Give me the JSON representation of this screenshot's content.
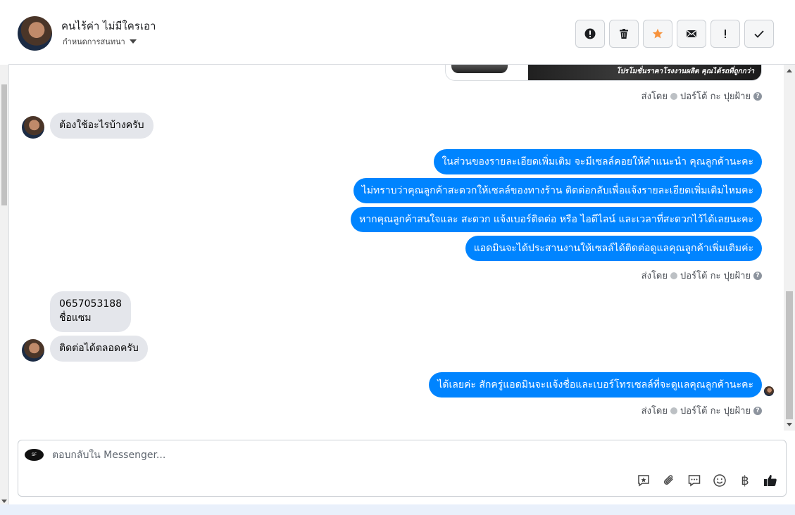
{
  "header": {
    "contact_name": "คนไร้ค่า ไม่มีใครเอา",
    "assign_label": "กำหนดการสนทนา"
  },
  "actions": [
    {
      "name": "mark-spam",
      "icon": "alert-circle-icon"
    },
    {
      "name": "delete",
      "icon": "trash-icon"
    },
    {
      "name": "star",
      "icon": "star-icon",
      "color": "#f7923b"
    },
    {
      "name": "mark-unread",
      "icon": "envelope-icon"
    },
    {
      "name": "follow-up",
      "icon": "exclamation-icon"
    },
    {
      "name": "done",
      "icon": "checkmark-icon"
    }
  ],
  "promo_banner_text": "โปรโมชั่นราคาโรงงานผลิต คุณได้รถที่ถูกกว่า",
  "sent_by": {
    "prefix": "ส่งโดย",
    "name": "ปอร์โต้ กะ ปุยฝ้าย"
  },
  "messages": {
    "in_1": "ต้องใช้อะไรบ้างครับ",
    "out_1": "ในส่วนของรายละเอียดเพิ่มเติม จะมีเซลล์คอยให้คำแนะนำ คุณลูกค้านะคะ",
    "out_2": "ไม่ทราบว่าคุณลูกค้าสะดวกให้เซลล์ของทางร้าน ติดต่อกลับเพื่อแจ้งรายละเอียดเพิ่มเติมไหมคะ",
    "out_3": "หากคุณลูกค้าสนใจและ สะดวก แจ้งเบอร์ติดต่อ หรือ ไอดีไลน์ และเวลาที่สะดวกไว้ได้เลยนะคะ",
    "out_4": "แอดมินจะได้ประสานงานให้เซลล์ได้ติดต่อดูแลคุณลูกค้าเพิ่มเติมค่ะ",
    "in_2_line1": "0657053188",
    "in_2_line2": "ชื่อแซม",
    "in_3": "ติดต่อได้ตลอดครับ",
    "out_5": "ได้เลยค่ะ สักครู่แอดมินจะแจ้งชื่อและเบอร์โทรเซลล์ที่จะดูแลคุณลูกค้านะคะ"
  },
  "composer": {
    "placeholder": "ตอบกลับใน Messenger...",
    "tools": [
      "saved-reply-icon",
      "attachment-icon",
      "chat-bubble-icon",
      "emoji-icon",
      "baht-icon",
      "thumbs-up-icon"
    ],
    "baht_symbol": "฿"
  },
  "colors": {
    "outgoing_bubble": "#0084ff",
    "incoming_bubble": "#e4e6eb",
    "star": "#f7923b"
  }
}
